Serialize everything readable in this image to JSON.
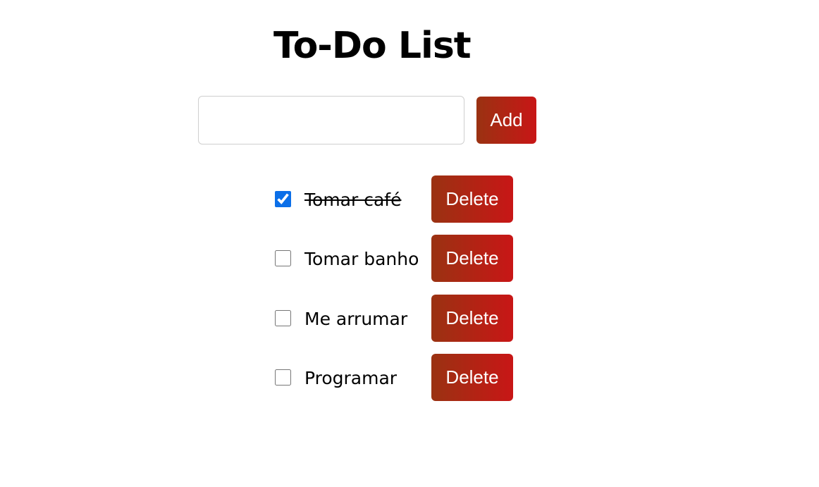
{
  "header": {
    "title": "To-Do List"
  },
  "new_todo": {
    "value": "",
    "placeholder": "",
    "add_label": "Add"
  },
  "todos": [
    {
      "text": "Tomar café",
      "done": true,
      "delete_label": "Delete"
    },
    {
      "text": "Tomar banho",
      "done": false,
      "delete_label": "Delete"
    },
    {
      "text": "Me arrumar",
      "done": false,
      "delete_label": "Delete"
    },
    {
      "text": "Programar",
      "done": false,
      "delete_label": "Delete"
    }
  ],
  "colors": {
    "button_gradient_start": "#9a3212",
    "button_gradient_end": "#c81616",
    "checkbox_accent": "#0b6fe8"
  }
}
